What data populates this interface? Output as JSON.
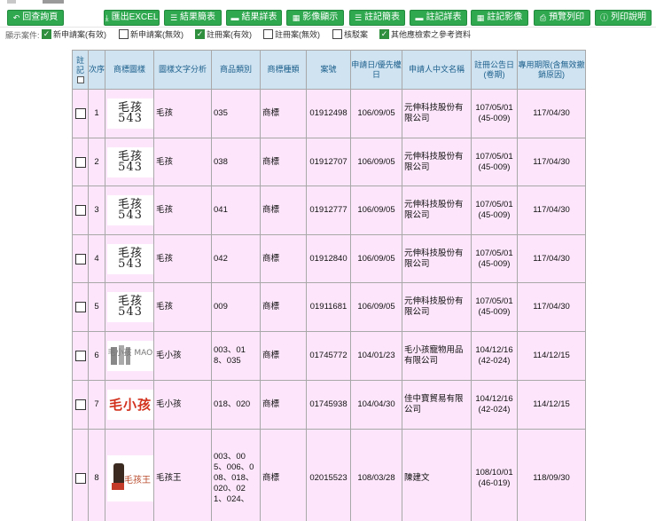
{
  "toolbar": {
    "back": "回查詢頁",
    "export_excel": "匯出EXCEL",
    "result_brief": "結果簡表",
    "result_detail": "結果詳表",
    "image_display": "影像顯示",
    "note_brief": "註記簡表",
    "note_detail": "註記詳表",
    "note_image": "註記影像",
    "preview_print": "預覽列印",
    "print_help": "列印說明"
  },
  "filters": {
    "label": "顯示案件:",
    "options": [
      {
        "label": "新申請案(有效)",
        "checked": true
      },
      {
        "label": "新申請案(無效)",
        "checked": false
      },
      {
        "label": "註冊案(有效)",
        "checked": true
      },
      {
        "label": "註冊案(無效)",
        "checked": false
      },
      {
        "label": "核駁案",
        "checked": false
      },
      {
        "label": "其他應檢索之參考資料",
        "checked": true
      }
    ]
  },
  "table": {
    "headers": {
      "note": "註記",
      "seq": "次序",
      "image": "商標圖樣",
      "text_analysis": "圖樣文字分析",
      "goods_class": "商品類別",
      "mark_type": "商標種類",
      "case_no": "案號",
      "app_date": "申請日/優先權日",
      "applicant": "申請人中文名稱",
      "reg_date": "註冊公告日(卷期)",
      "term": "專用期限(含無效撤銷原因)"
    },
    "rows": [
      {
        "seq": "1",
        "mark": "毛孩543",
        "mark_style": "text",
        "text": "毛孩",
        "goods": "035",
        "type": "商標",
        "case_no": "01912498",
        "app_date": "106/09/05",
        "applicant": "元伸科技股份有限公司",
        "reg_date": "107/05/01",
        "reg_vol": "(45-009)",
        "term": "117/04/30"
      },
      {
        "seq": "2",
        "mark": "毛孩543",
        "mark_style": "text",
        "text": "毛孩",
        "goods": "038",
        "type": "商標",
        "case_no": "01912707",
        "app_date": "106/09/05",
        "applicant": "元伸科技股份有限公司",
        "reg_date": "107/05/01",
        "reg_vol": "(45-009)",
        "term": "117/04/30"
      },
      {
        "seq": "3",
        "mark": "毛孩543",
        "mark_style": "text",
        "text": "毛孩",
        "goods": "041",
        "type": "商標",
        "case_no": "01912777",
        "app_date": "106/09/05",
        "applicant": "元伸科技股份有限公司",
        "reg_date": "107/05/01",
        "reg_vol": "(45-009)",
        "term": "117/04/30"
      },
      {
        "seq": "4",
        "mark": "毛孩543",
        "mark_style": "text",
        "text": "毛孩",
        "goods": "042",
        "type": "商標",
        "case_no": "01912840",
        "app_date": "106/09/05",
        "applicant": "元伸科技股份有限公司",
        "reg_date": "107/05/01",
        "reg_vol": "(45-009)",
        "term": "117/04/30"
      },
      {
        "seq": "5",
        "mark": "毛孩543",
        "mark_style": "text",
        "text": "毛孩",
        "goods": "009",
        "type": "商標",
        "case_no": "01911681",
        "app_date": "106/09/05",
        "applicant": "元伸科技股份有限公司",
        "reg_date": "107/05/01",
        "reg_vol": "(45-009)",
        "term": "117/04/30"
      },
      {
        "seq": "6",
        "mark": "毛小孩 MAO LOVE",
        "mark_style": "logo-grey",
        "text": "毛小孩",
        "goods": "003、018、035",
        "type": "商標",
        "case_no": "01745772",
        "app_date": "104/01/23",
        "applicant": "毛小孩寵物用品有限公司",
        "reg_date": "104/12/16",
        "reg_vol": "(42-024)",
        "term": "114/12/15"
      },
      {
        "seq": "7",
        "mark": "毛小孩",
        "mark_style": "logo-red",
        "text": "毛小孩",
        "goods": "018、020",
        "type": "商標",
        "case_no": "01745938",
        "app_date": "104/04/30",
        "applicant": "佳中寶貿易有限公司",
        "reg_date": "104/12/16",
        "reg_vol": "(42-024)",
        "term": "114/12/15"
      },
      {
        "seq": "8",
        "mark": "毛孩王",
        "mark_style": "logo-dog",
        "text": "毛孩王",
        "goods": "003、005、006、008、018、020、021、024、",
        "type": "商標",
        "case_no": "02015523",
        "app_date": "108/03/28",
        "applicant": "陳建文",
        "reg_date": "108/10/01",
        "reg_vol": "(46-019)",
        "term": "118/09/30"
      }
    ]
  }
}
